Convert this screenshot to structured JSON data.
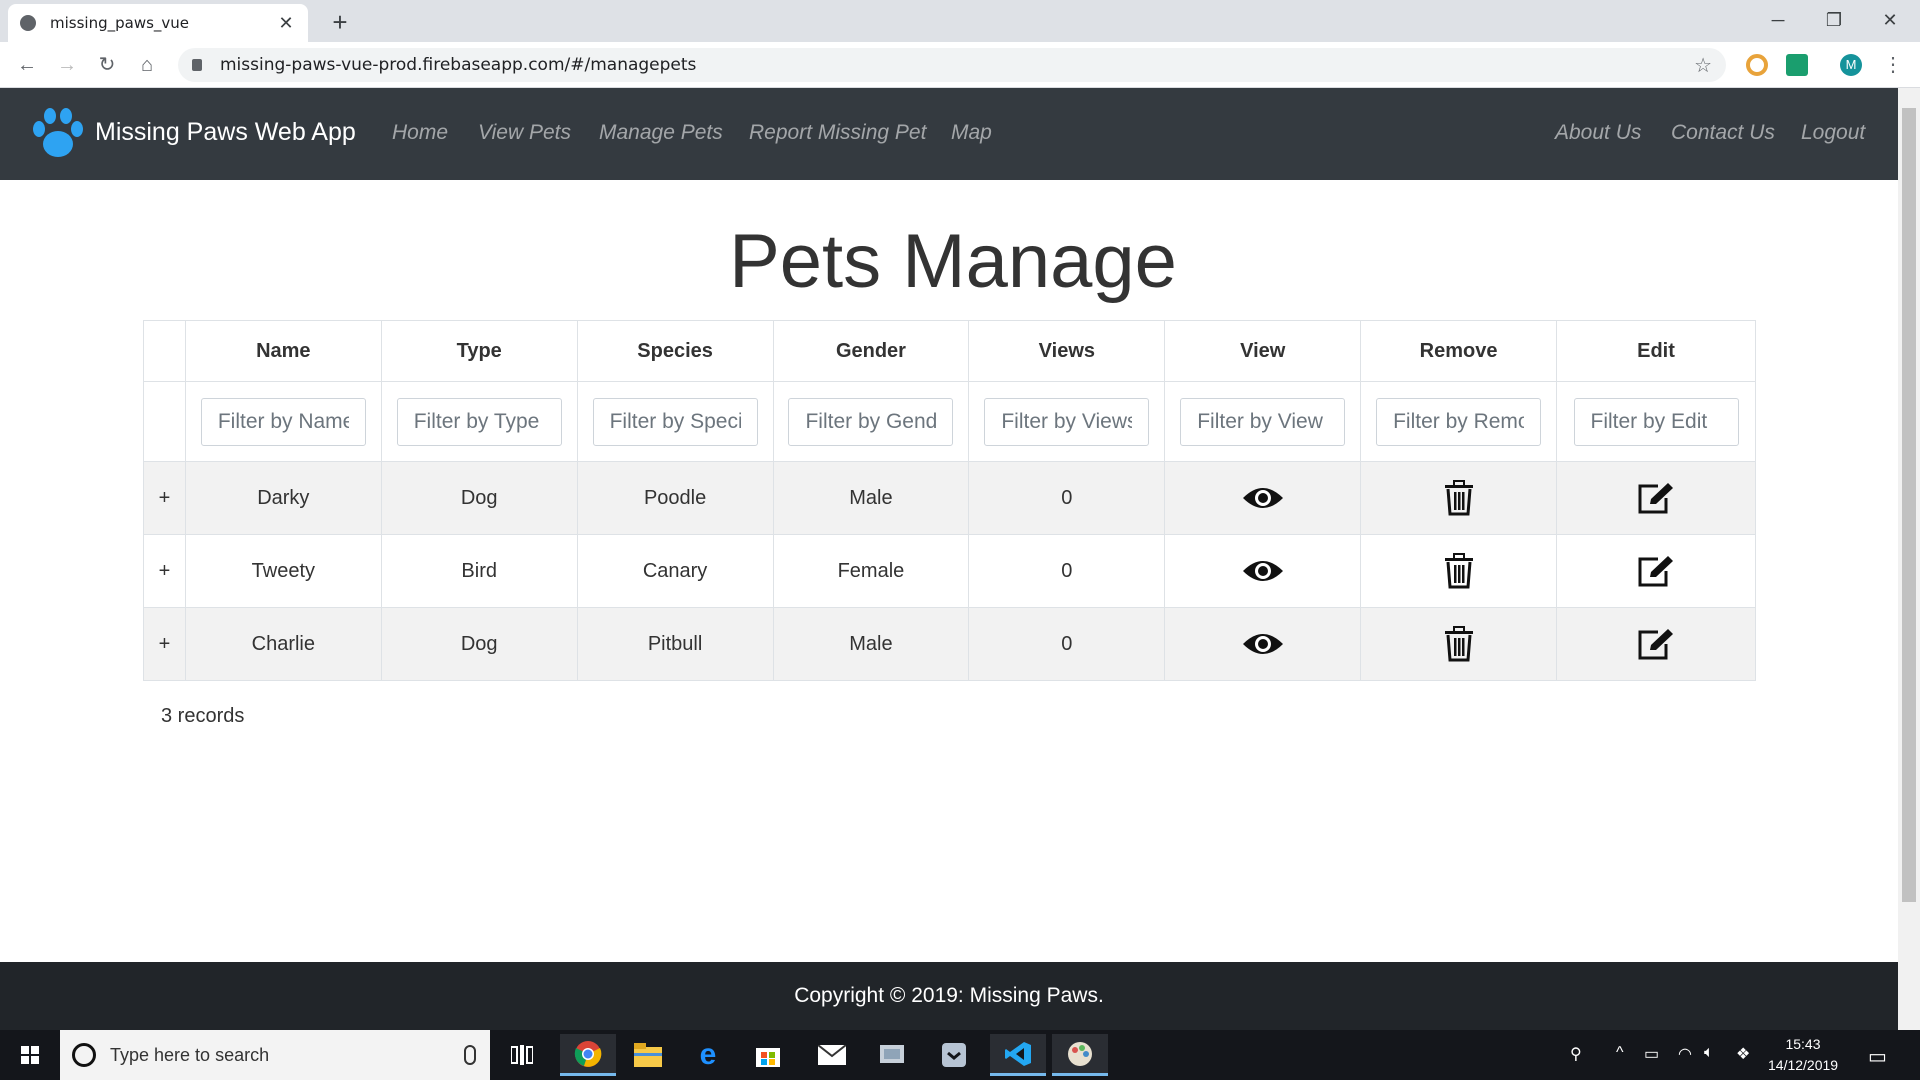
{
  "browser": {
    "tab_title": "missing_paws_vue",
    "url": "missing-paws-vue-prod.firebaseapp.com/#/managepets",
    "profile_initial": "M"
  },
  "navbar": {
    "brand": "Missing Paws Web App",
    "links": [
      "Home",
      "View Pets",
      "Manage Pets",
      "Report Missing Pet",
      "Map"
    ],
    "right_links": [
      "About Us",
      "Contact Us",
      "Logout"
    ]
  },
  "page": {
    "heading": "Pets Manage",
    "columns": [
      "Name",
      "Type",
      "Species",
      "Gender",
      "Views",
      "View",
      "Remove",
      "Edit"
    ],
    "filters": [
      "Filter by Name",
      "Filter by Type",
      "Filter by Species",
      "Filter by Gender",
      "Filter by Views",
      "Filter by View",
      "Filter by Remove",
      "Filter by Edit"
    ],
    "rows": [
      {
        "expand": "+",
        "name": "Darky",
        "type": "Dog",
        "species": "Poodle",
        "gender": "Male",
        "views": "0"
      },
      {
        "expand": "+",
        "name": "Tweety",
        "type": "Bird",
        "species": "Canary",
        "gender": "Female",
        "views": "0"
      },
      {
        "expand": "+",
        "name": "Charlie",
        "type": "Dog",
        "species": "Pitbull",
        "gender": "Male",
        "views": "0"
      }
    ],
    "records": "3 records"
  },
  "footer": {
    "text": "Copyright © 2019: Missing Paws."
  },
  "taskbar": {
    "search_placeholder": "Type here to search",
    "time": "15:43",
    "date": "14/12/2019"
  },
  "colors": {
    "navbar": "#343a40",
    "footer": "#212529",
    "paw": "#2ea3f2"
  }
}
